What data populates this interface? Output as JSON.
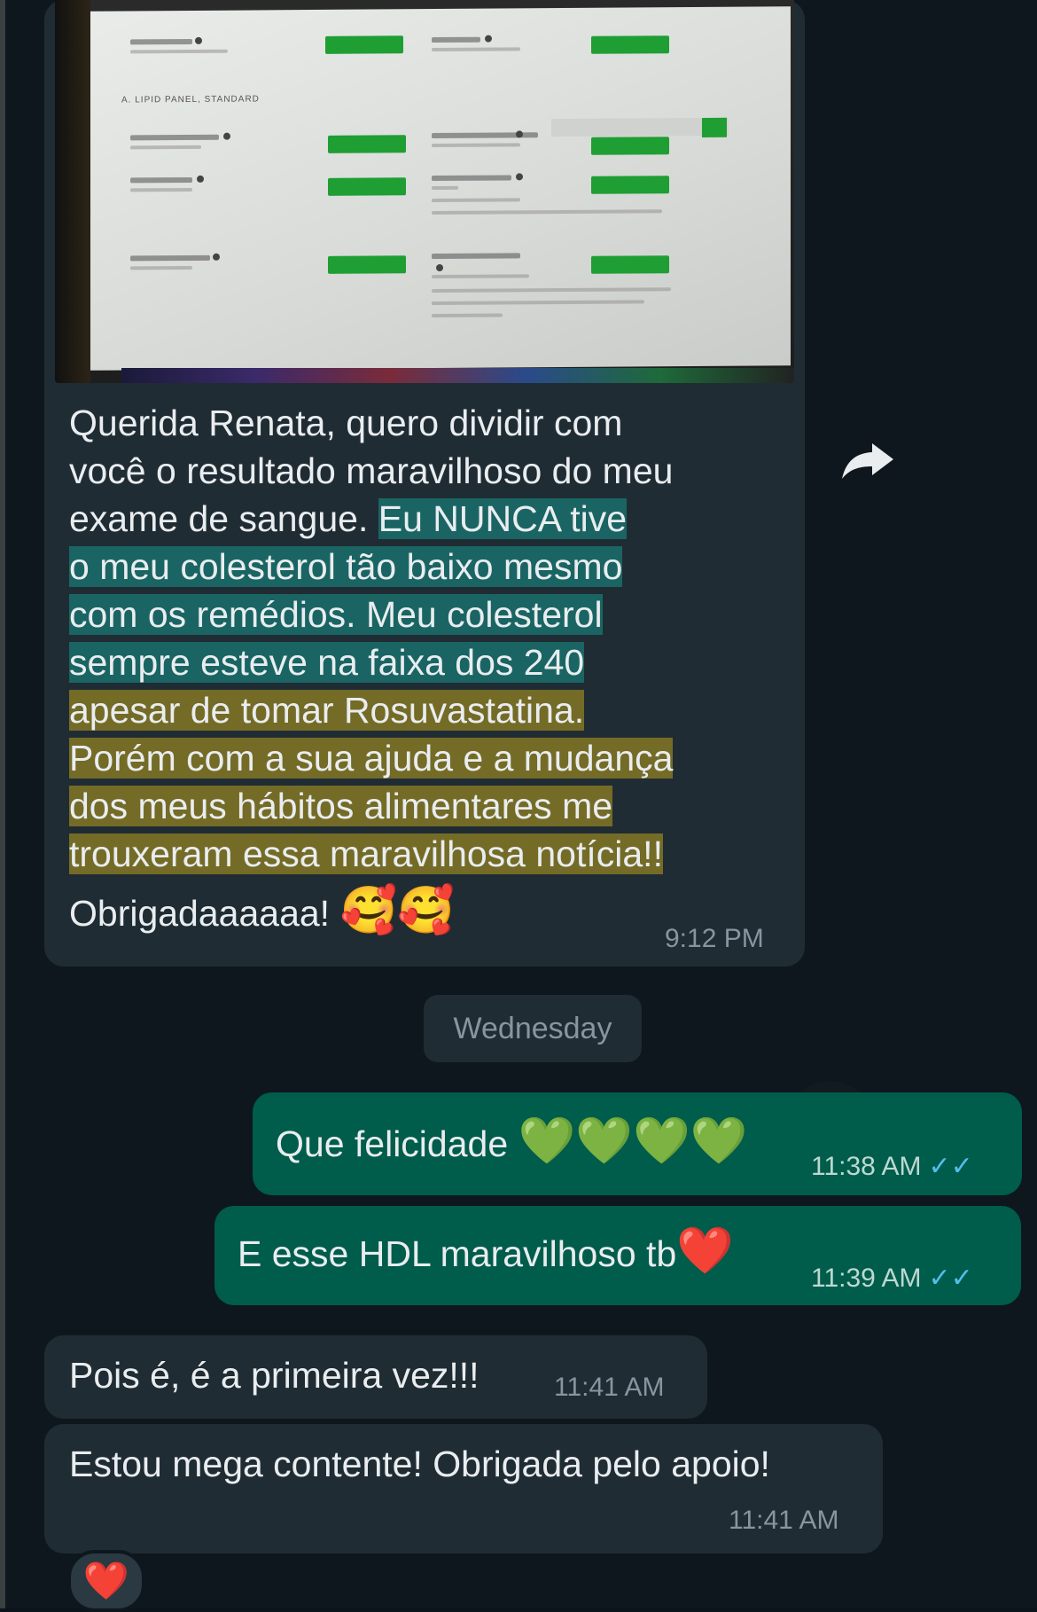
{
  "messages": {
    "photo_message": {
      "text_plain_1": "Querida Renata, quero dividir com",
      "text_plain_2": "você o resultado maravilhoso do meu",
      "text_plain_3": "exame de sangue. ",
      "text_blue_1": "Eu NUNCA tive",
      "text_blue_2": "o meu colesterol tão baixo mesmo",
      "text_blue_3": "com os remédios. Meu colesterol",
      "text_blue_4": "sempre esteve na faixa dos 240",
      "text_yellow_1": "apesar de tomar Rosuvastatina.",
      "text_yellow_2": "Porém com a sua ajuda e a mudança",
      "text_yellow_3": "dos meus hábitos alimentares me",
      "text_yellow_4": "trouxeram essa maravilhosa notícia!!",
      "text_last": "Obrigadaaaaaa!",
      "emoji": "🥰🥰",
      "time": "9:12 PM",
      "photo_caption_visible": "A. LIPID PANEL, STANDARD"
    },
    "day_separator": "Wednesday",
    "out_1": {
      "text": "Que felicidade ",
      "emoji": "💚💚💚💚",
      "time": "11:38 AM",
      "ticks": "✓✓"
    },
    "out_2": {
      "text": "E esse HDL maravilhoso tb",
      "emoji": "❤️",
      "time": "11:39 AM",
      "ticks": "✓✓"
    },
    "in_1": {
      "text": "Pois é, é a primeira vez!!!",
      "time": "11:41 AM"
    },
    "in_2": {
      "text": "Estou mega contente! Obrigada pelo apoio!",
      "time": "11:41 AM"
    },
    "reaction": "❤️"
  },
  "icons": {
    "forward": "forward-arrow-icon",
    "read_receipt": "double-check-icon"
  },
  "colors": {
    "background": "#0e171d",
    "incoming_bubble": "#202c33",
    "outgoing_bubble": "#005c4b",
    "highlight_blue": "#16968c",
    "highlight_yellow": "#b9a01e",
    "read_ticks": "#53bdeb"
  }
}
